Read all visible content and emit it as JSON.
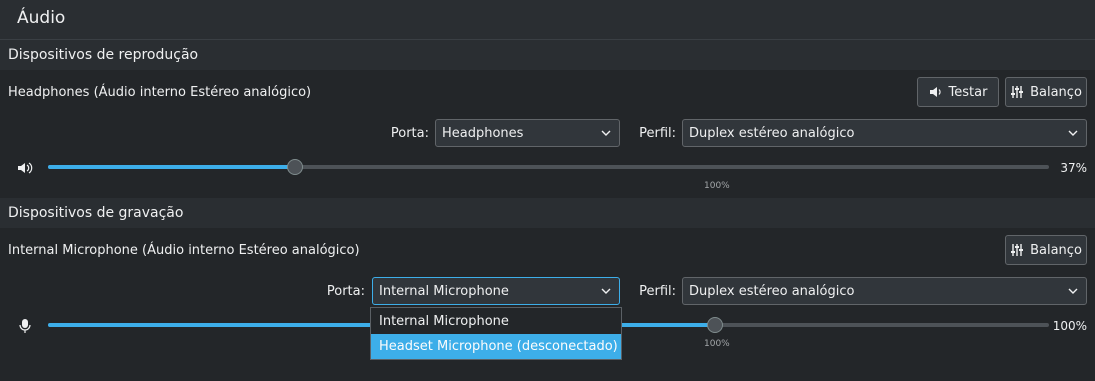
{
  "title": "Áudio",
  "playback": {
    "section_label": "Dispositivos de reprodução",
    "device_name": "Headphones (Áudio interno Estéreo analógico)",
    "test_button": "Testar",
    "balance_button": "Balanço",
    "port_label": "Porta:",
    "port_value": "Headphones",
    "profile_label": "Perfil:",
    "profile_value": "Duplex estéreo analógico",
    "volume_percent": "37%",
    "volume_value": 37,
    "reference_mark": "100%"
  },
  "recording": {
    "section_label": "Dispositivos de gravação",
    "device_name": "Internal Microphone (Áudio interno Estéreo analógico)",
    "balance_button": "Balanço",
    "port_label": "Porta:",
    "port_value": "Internal Microphone",
    "profile_label": "Perfil:",
    "profile_value": "Duplex estéreo analógico",
    "volume_percent": "100%",
    "volume_value": 100,
    "reference_mark": "100%"
  },
  "port_dropdown": {
    "options": [
      "Internal Microphone",
      "Headset Microphone (desconectado)"
    ],
    "highlighted_index": 1
  },
  "colors": {
    "accent": "#3daee9",
    "background": "#232629",
    "header": "#2a2e32"
  }
}
